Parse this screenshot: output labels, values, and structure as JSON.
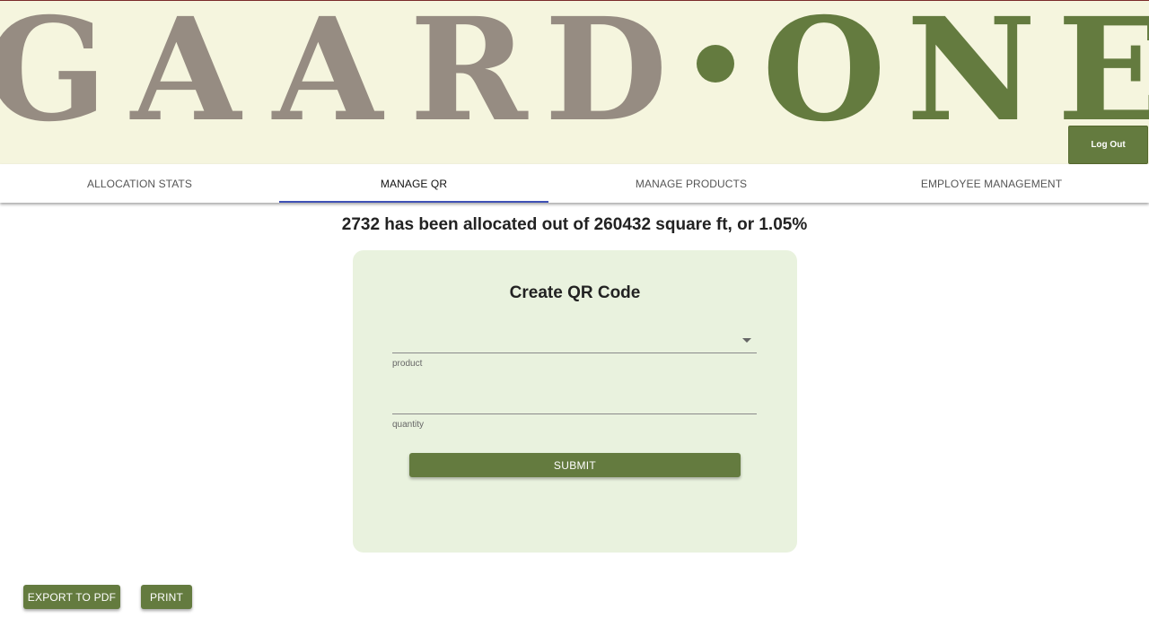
{
  "brand": {
    "logo_text": "GAARD·ONE",
    "logo_parts": [
      "G",
      "A",
      "A",
      "R",
      "D",
      "O",
      "N",
      "E"
    ],
    "colors": {
      "gaard": "#968c82",
      "one": "#647b3f",
      "header_bg": "#f5f5de"
    }
  },
  "header": {
    "logout_label": "Log Out"
  },
  "tabs": [
    {
      "label": "ALLOCATION STATS",
      "active": false
    },
    {
      "label": "MANAGE QR",
      "active": true
    },
    {
      "label": "MANAGE PRODUCTS",
      "active": false
    },
    {
      "label": "EMPLOYEE MANAGEMENT",
      "active": false
    }
  ],
  "allocation": {
    "text": "2732 has been allocated out of 260432 square ft, or 1.05%"
  },
  "form": {
    "title": "Create QR Code",
    "product_value": "",
    "product_helper": "product",
    "quantity_value": "",
    "quantity_helper": "quantity",
    "submit_label": "SUBMIT"
  },
  "actions": {
    "export_label": "EXPORT TO PDF",
    "print_label": "PRINT"
  },
  "colors": {
    "accent": "#647b3f",
    "tab_indicator": "#3f51b5",
    "card_bg": "#e9f2de"
  },
  "icons": {
    "select_caret": "caret-down-icon"
  }
}
